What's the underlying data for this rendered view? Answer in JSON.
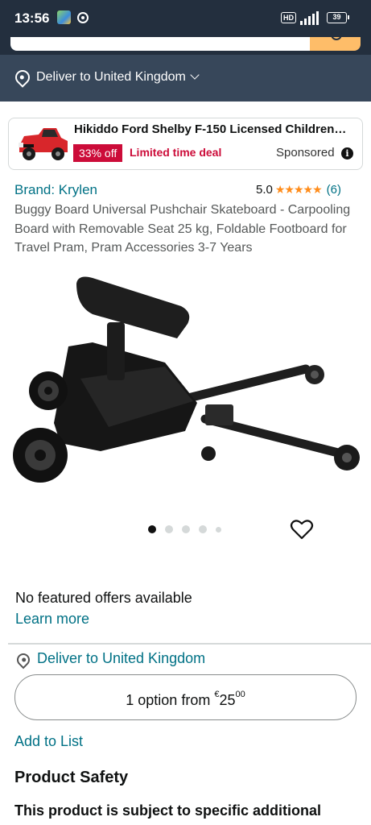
{
  "status_bar": {
    "time": "13:56",
    "network": "HD",
    "battery": "39"
  },
  "header": {
    "deliver_label": "Deliver to United Kingdom"
  },
  "sponsored_ad": {
    "title": "Hikiddo Ford Shelby F-150 Licensed Children's...",
    "discount_badge": "33% off",
    "deal_label": "Limited time deal",
    "sponsored_label": "Sponsored"
  },
  "product": {
    "brand": "Brand: Krylen",
    "rating_value": "5.0",
    "stars": "★★★★★",
    "rating_count": "(6)",
    "title": "Buggy Board Universal Pushchair Skateboard - Carpooling Board with Removable Seat 25 kg, Foldable Footboard for Travel Pram, Pram Accessories 3-7 Years",
    "image_count": 5,
    "active_image": 1
  },
  "offers": {
    "no_offers_text": "No featured offers available",
    "learn_more": "Learn more",
    "deliver_label": "Deliver to United Kingdom",
    "option_prefix": "1 option from ",
    "currency": "€",
    "price_whole": "25",
    "price_fraction": "00",
    "add_to_list": "Add to List"
  },
  "safety": {
    "heading": "Product Safety",
    "text": "This product is subject to specific additional"
  },
  "colors": {
    "header_dark": "#232f3e",
    "deliver_bar": "#37475a",
    "search_button": "#febd69",
    "link": "#007185",
    "deal_red": "#cc0c39",
    "star": "#ff8c1a"
  },
  "icons": [
    "location-pin-icon",
    "chevron-down-icon",
    "info-icon",
    "heart-icon",
    "search-icon"
  ]
}
